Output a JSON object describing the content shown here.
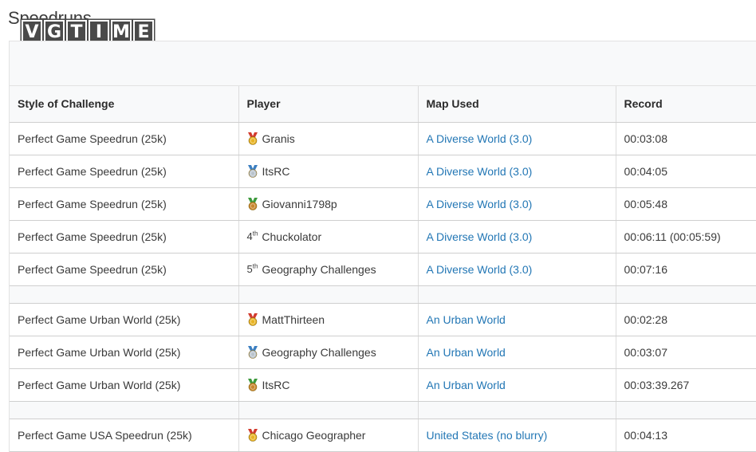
{
  "page": {
    "title": "Speedruns"
  },
  "watermark": {
    "text": "VGTIME",
    "letters": [
      "V",
      "G",
      "T",
      "I",
      "M",
      "E"
    ]
  },
  "table": {
    "headers": [
      "Style of Challenge",
      "Player",
      "Map Used",
      "Record"
    ],
    "rows": [
      {
        "challenge": "Perfect Game Speedrun (25k)",
        "medal": "gold",
        "rank": "",
        "rank_suffix": "",
        "player": "Granis",
        "map": "A Diverse World (3.0)",
        "record": "00:03:08"
      },
      {
        "challenge": "Perfect Game Speedrun (25k)",
        "medal": "silver",
        "rank": "",
        "rank_suffix": "",
        "player": "ItsRC",
        "map": "A Diverse World (3.0)",
        "record": "00:04:05"
      },
      {
        "challenge": "Perfect Game Speedrun (25k)",
        "medal": "bronze",
        "rank": "",
        "rank_suffix": "",
        "player": "Giovanni1798p",
        "map": "A Diverse World (3.0)",
        "record": "00:05:48"
      },
      {
        "challenge": "Perfect Game Speedrun (25k)",
        "medal": "",
        "rank": "4",
        "rank_suffix": "th",
        "player": "Chuckolator",
        "map": "A Diverse World (3.0)",
        "record": "00:06:11 (00:05:59)"
      },
      {
        "challenge": "Perfect Game Speedrun (25k)",
        "medal": "",
        "rank": "5",
        "rank_suffix": "th",
        "player": "Geography Challenges",
        "map": "A Diverse World (3.0)",
        "record": "00:07:16"
      },
      {
        "spacer": true
      },
      {
        "challenge": "Perfect Game Urban World (25k)",
        "medal": "gold",
        "rank": "",
        "rank_suffix": "",
        "player": "MattThirteen",
        "map": "An Urban World",
        "record": "00:02:28"
      },
      {
        "challenge": "Perfect Game Urban World (25k)",
        "medal": "silver",
        "rank": "",
        "rank_suffix": "",
        "player": "Geography Challenges",
        "map": "An Urban World",
        "record": "00:03:07"
      },
      {
        "challenge": "Perfect Game Urban World (25k)",
        "medal": "bronze",
        "rank": "",
        "rank_suffix": "",
        "player": "ItsRC",
        "map": "An Urban World",
        "record": "00:03:39.267"
      },
      {
        "spacer": true
      },
      {
        "challenge": "Perfect Game USA Speedrun (25k)",
        "medal": "gold",
        "rank": "",
        "rank_suffix": "",
        "player": "Chicago Geographer",
        "map": "United States (no blurry)",
        "record": "00:04:13"
      }
    ]
  },
  "medal_colors": {
    "gold": {
      "ribbon": "#d23b2e",
      "disc": "#e8b424"
    },
    "silver": {
      "ribbon": "#3c7fc1",
      "disc": "#b9c3cc"
    },
    "bronze": {
      "ribbon": "#3d9a3d",
      "disc": "#c8862e"
    }
  }
}
